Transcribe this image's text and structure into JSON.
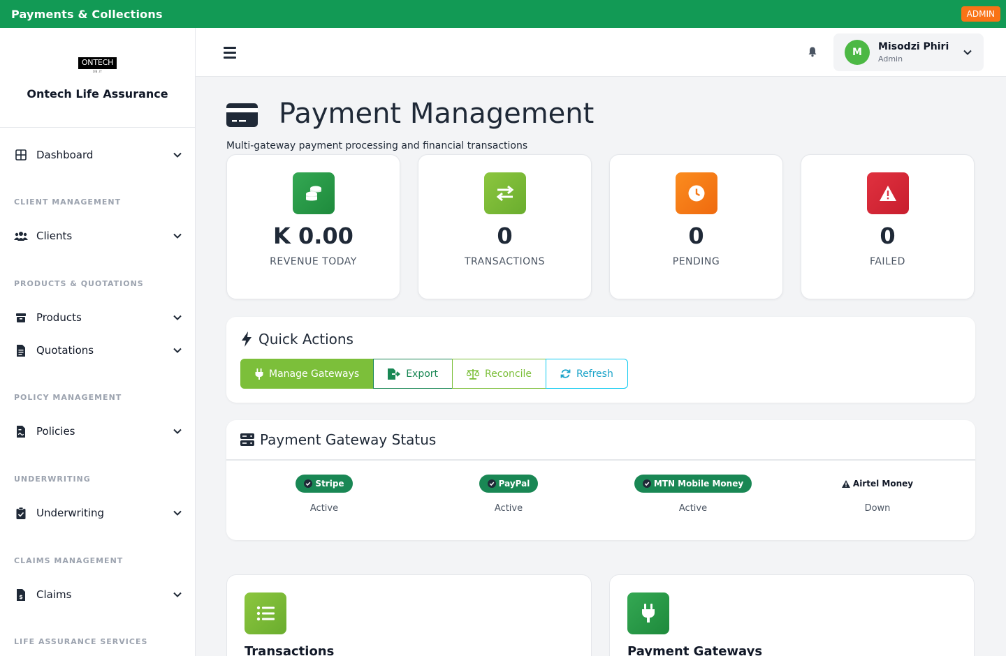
{
  "topbar": {
    "title": "Payments & Collections",
    "badge": "ADMIN"
  },
  "brand": {
    "logo_text": "ONTECH",
    "logo_sub": "ON.IT",
    "company": "Ontech Life Assurance"
  },
  "sidebar": {
    "dashboard": "Dashboard",
    "sections": {
      "client_management": "CLIENT MANAGEMENT",
      "products_quotations": "PRODUCTS & QUOTATIONS",
      "policy_management": "POLICY MANAGEMENT",
      "underwriting": "UNDERWRITING",
      "claims_management": "CLAIMS MANAGEMENT",
      "life_assurance_services": "LIFE ASSURANCE SERVICES"
    },
    "items": {
      "clients": "Clients",
      "products": "Products",
      "quotations": "Quotations",
      "policies": "Policies",
      "underwriting": "Underwriting",
      "claims": "Claims"
    }
  },
  "header": {
    "user_initial": "M",
    "user_name": "Misodzi Phiri",
    "user_role": "Admin"
  },
  "page": {
    "title": "Payment Management",
    "subtitle": "Multi-gateway payment processing and financial transactions"
  },
  "stats": [
    {
      "value": "K 0.00",
      "label": "REVENUE TODAY",
      "icon": "coins-icon",
      "color": "#2e9a47"
    },
    {
      "value": "0",
      "label": "TRANSACTIONS",
      "icon": "exchange-icon",
      "color": "#7cbf3a"
    },
    {
      "value": "0",
      "label": "PENDING",
      "icon": "clock-icon",
      "color": "#f47716"
    },
    {
      "value": "0",
      "label": "FAILED",
      "icon": "warning-icon",
      "color": "#dc3545"
    }
  ],
  "quick_actions": {
    "title": "Quick Actions",
    "manage_gateways": "Manage Gateways",
    "export": "Export",
    "reconcile": "Reconcile",
    "refresh": "Refresh"
  },
  "gateway_status": {
    "title": "Payment Gateway Status",
    "gateways": [
      {
        "name": "Stripe",
        "status": "Active"
      },
      {
        "name": "PayPal",
        "status": "Active"
      },
      {
        "name": "MTN Mobile Money",
        "status": "Active"
      },
      {
        "name": "Airtel Money",
        "status": "Down"
      }
    ]
  },
  "bottom_cards": {
    "transactions": "Transactions",
    "payment_gateways": "Payment Gateways"
  },
  "colors": {
    "brand_green": "#129a55",
    "accent_green": "#7cbf3a",
    "info": "#0dcaf0",
    "badge_green": "#198754",
    "admin_orange": "#f97316"
  }
}
